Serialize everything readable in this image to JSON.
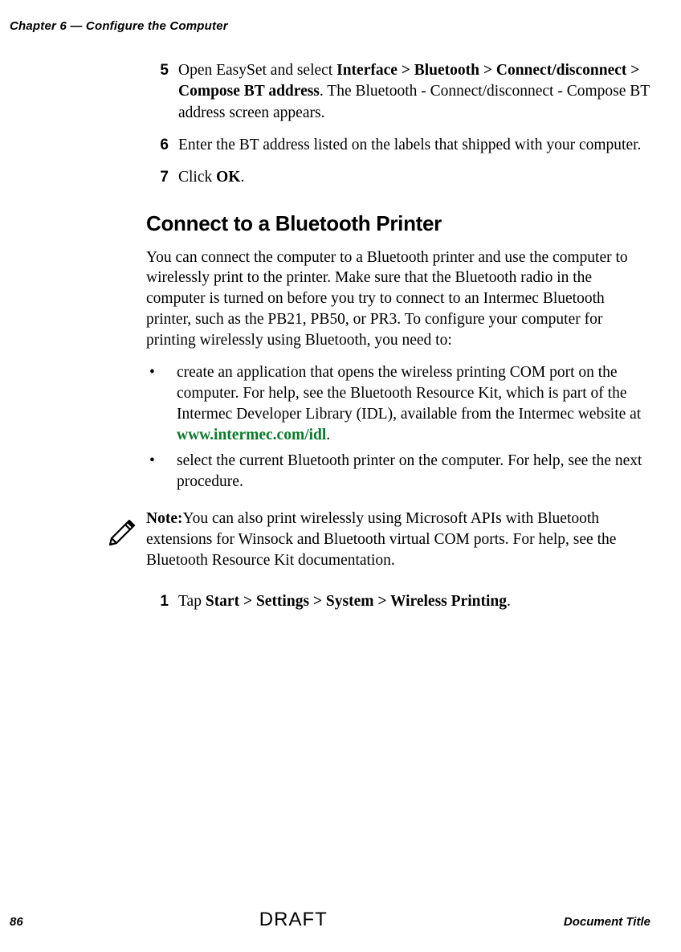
{
  "header": {
    "running": "Chapter 6 — Configure the Computer"
  },
  "steps_top": [
    {
      "num": "5",
      "pre": "Open EasySet and select ",
      "bold": "Interface > Bluetooth > Connect/disconnect > Compose BT address",
      "post": ". The Bluetooth - Connect/disconnect - Compose BT address screen appears."
    },
    {
      "num": "6",
      "pre": "Enter the BT address listed on the labels that shipped with your computer.",
      "bold": "",
      "post": ""
    },
    {
      "num": "7",
      "pre": "Click ",
      "bold": "OK",
      "post": "."
    }
  ],
  "h2": "Connect to a Bluetooth Printer",
  "intro": "You can connect the computer to a Bluetooth printer and use the computer to wirelessly print to the printer. Make sure that the Bluetooth radio in the computer is turned on before you try to connect to an Intermec Bluetooth printer, such as the PB21, PB50, or PR3. To configure your computer for printing wirelessly using Bluetooth, you need to:",
  "bullets": [
    {
      "pre": "create an application that opens the wireless printing COM port on the computer. For help, see the Bluetooth Resource Kit, which is part of the Intermec Developer Library (IDL), available from the Intermec website at ",
      "link": "www.intermec.com/idl",
      "post": "."
    },
    {
      "pre": "select the current Bluetooth printer on the computer. For help, see the next procedure.",
      "link": "",
      "post": ""
    }
  ],
  "note": {
    "label": "Note:",
    "body": "You can also print wirelessly using Microsoft APIs with Bluetooth extensions for Winsock and Bluetooth virtual COM ports. For help, see the Bluetooth Resource Kit documentation."
  },
  "step_after_note": {
    "num": "1",
    "pre": "Tap ",
    "bold": "Start > Settings > System > Wireless Printing",
    "post": "."
  },
  "footer": {
    "page": "86",
    "watermark": "DRAFT",
    "title": "Document Title"
  }
}
